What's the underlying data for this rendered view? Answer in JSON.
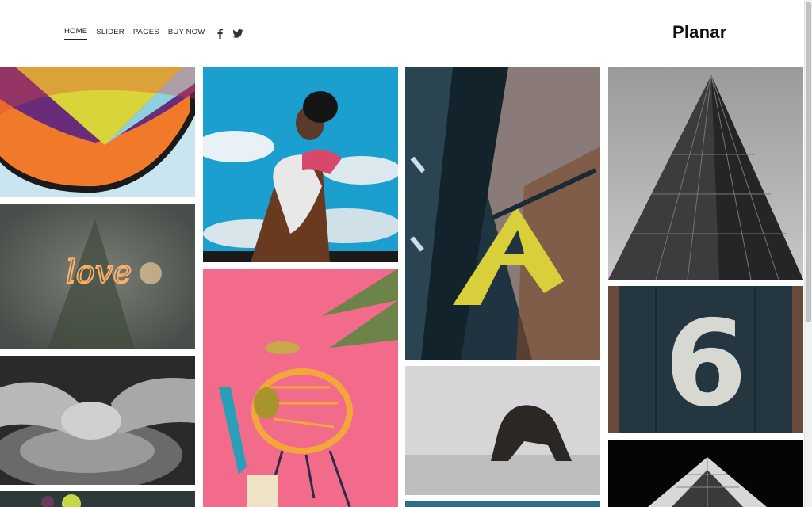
{
  "site": {
    "logo": "Planar"
  },
  "nav": {
    "items": [
      {
        "label": "HOME",
        "active": true
      },
      {
        "label": "SLIDER",
        "active": false
      },
      {
        "label": "PAGES",
        "active": false
      },
      {
        "label": "BUY NOW",
        "active": false
      }
    ],
    "social": [
      "facebook-icon",
      "twitter-icon"
    ]
  },
  "gallery": {
    "tiles": [
      {
        "name": "graffiti-photo",
        "subject": "colorful graffiti"
      },
      {
        "name": "sparkler-love-photo",
        "subject": "sparkler writing",
        "text": "love"
      },
      {
        "name": "pottery-wheel-photo",
        "subject": "hands on pottery wheel"
      },
      {
        "name": "cocktail-photo",
        "subject": "drinks"
      },
      {
        "name": "man-sky-photo",
        "subject": "man against blue sky"
      },
      {
        "name": "pink-chair-photo",
        "subject": "chair on pink background"
      },
      {
        "name": "letter-a-sign-photo",
        "subject": "letter A sign",
        "text": "A"
      },
      {
        "name": "sea-rock-photo",
        "subject": "rock in the sea"
      },
      {
        "name": "skyscraper-photo",
        "subject": "skyscraper"
      },
      {
        "name": "number-six-door-photo",
        "subject": "number six on door",
        "text": "6"
      },
      {
        "name": "building-night-photo",
        "subject": "building at night"
      },
      {
        "name": "teal-partial-photo",
        "subject": "partial image"
      }
    ]
  },
  "colors": {
    "pink": "#f26b8a",
    "sky": "#1a9fcf",
    "teal": "#24363f",
    "orange": "#f07a2a"
  }
}
